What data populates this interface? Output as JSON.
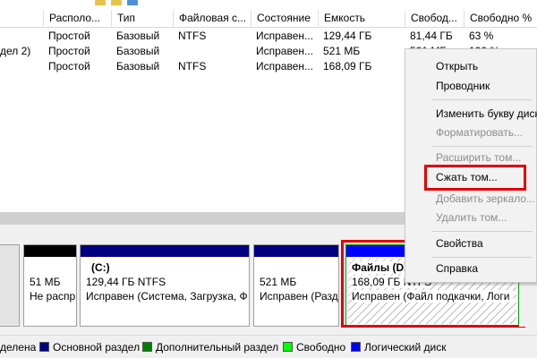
{
  "columns": [
    "Располо...",
    "Тип",
    "Файловая с...",
    "Состояние",
    "Емкость",
    "Свобод...",
    "Свободно %"
  ],
  "rows": [
    {
      "name": "",
      "layout": "Простой",
      "type": "Базовый",
      "fs": "NTFS",
      "status": "Исправен...",
      "capacity": "129,44 ГБ",
      "free": "81,44 ГБ",
      "free_pct": "63 %"
    },
    {
      "name": "дел 2)",
      "layout": "Простой",
      "type": "Базовый",
      "fs": "",
      "status": "Исправен...",
      "capacity": "521 МБ",
      "free": "521 МБ",
      "free_pct": "100 %"
    },
    {
      "name": "",
      "layout": "Простой",
      "type": "Базовый",
      "fs": "NTFS",
      "status": "Исправен...",
      "capacity": "168,09 ГБ",
      "free": "",
      "free_pct": ""
    }
  ],
  "partitions": [
    {
      "line1": "",
      "line2": "51 МБ",
      "line3": "Не распр"
    },
    {
      "line1": "(C:)",
      "line2": "129,44 ГБ NTFS",
      "line3": "Исправен (Система, Загрузка, Ф"
    },
    {
      "line1": "",
      "line2": "521 МБ",
      "line3": "Исправен (Разд"
    },
    {
      "line1": "Файлы  (D",
      "line2": "168,09 ГБ NTFS",
      "line3": "Исправен (Файл подкачки, Логи"
    }
  ],
  "legend": [
    {
      "label": "делена",
      "color": ""
    },
    {
      "label": "Основной раздел",
      "color": "#000080"
    },
    {
      "label": "Дополнительный раздел",
      "color": "#008000"
    },
    {
      "label": "Свободно",
      "color": "#00ff00"
    },
    {
      "label": "Логический диск",
      "color": "#0000ff"
    }
  ],
  "context_menu": {
    "items": [
      {
        "label": "Открыть",
        "enabled": true
      },
      {
        "label": "Проводник",
        "enabled": true
      },
      {
        "label": "Изменить букву диск",
        "enabled": true
      },
      {
        "label": "Форматировать...",
        "enabled": false
      },
      {
        "label": "Расширить том...",
        "enabled": false
      },
      {
        "label": "Сжать том...",
        "enabled": true
      },
      {
        "label": "Добавить зеркало...",
        "enabled": false
      },
      {
        "label": "Удалить том...",
        "enabled": false
      },
      {
        "label": "Свойства",
        "enabled": true
      },
      {
        "label": "Справка",
        "enabled": true
      }
    ]
  },
  "colors": {
    "primary_partition": "#000080",
    "logical_disk": "#0000ff",
    "highlight": "#e10000"
  }
}
